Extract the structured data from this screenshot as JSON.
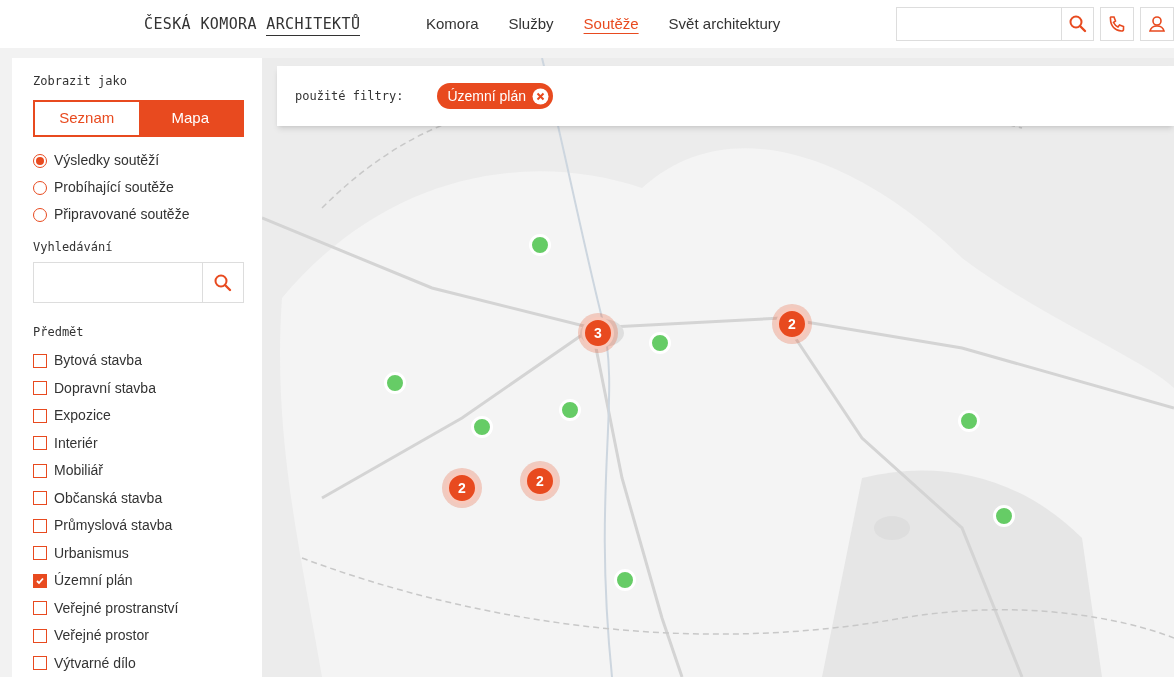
{
  "logo": {
    "text": "ČESKÁ KOMORA",
    "underlined": "ARCHITEKTŮ"
  },
  "nav": [
    {
      "label": "Komora",
      "selected": false
    },
    {
      "label": "Služby",
      "selected": false
    },
    {
      "label": "Soutěže",
      "selected": true
    },
    {
      "label": "Svět architektury",
      "selected": false
    }
  ],
  "sidebar": {
    "view_label": "Zobrazit jako",
    "view_toggle": [
      {
        "label": "Seznam",
        "selected": false
      },
      {
        "label": "Mapa",
        "selected": true
      }
    ],
    "modes": [
      {
        "label": "Výsledky soutěží",
        "selected": true
      },
      {
        "label": "Probíhající soutěže",
        "selected": false
      },
      {
        "label": "Připravované soutěže",
        "selected": false
      }
    ],
    "search_label": "Vyhledávání",
    "subject_label": "Předmět",
    "subjects": [
      {
        "label": "Bytová stavba",
        "checked": false
      },
      {
        "label": "Dopravní stavba",
        "checked": false
      },
      {
        "label": "Expozice",
        "checked": false
      },
      {
        "label": "Interiér",
        "checked": false
      },
      {
        "label": "Mobiliář",
        "checked": false
      },
      {
        "label": "Občanská stavba",
        "checked": false
      },
      {
        "label": "Průmyslová stavba",
        "checked": false
      },
      {
        "label": "Urbanismus",
        "checked": false
      },
      {
        "label": "Územní plán",
        "checked": true
      },
      {
        "label": "Veřejné prostranství",
        "checked": false
      },
      {
        "label": "Veřejné prostor",
        "checked": false
      },
      {
        "label": "Výtvarné dílo",
        "checked": false
      }
    ]
  },
  "filters": {
    "label": "použité filtry:",
    "chips": [
      "Územní plán"
    ]
  },
  "map": {
    "markers": [
      {
        "kind": "point"
      },
      {
        "kind": "cluster",
        "count": "3"
      },
      {
        "kind": "point"
      },
      {
        "kind": "cluster",
        "count": "2"
      },
      {
        "kind": "point"
      },
      {
        "kind": "point"
      },
      {
        "kind": "point"
      },
      {
        "kind": "point"
      },
      {
        "kind": "cluster",
        "count": "2"
      },
      {
        "kind": "cluster",
        "count": "2"
      },
      {
        "kind": "point"
      },
      {
        "kind": "point"
      }
    ]
  }
}
